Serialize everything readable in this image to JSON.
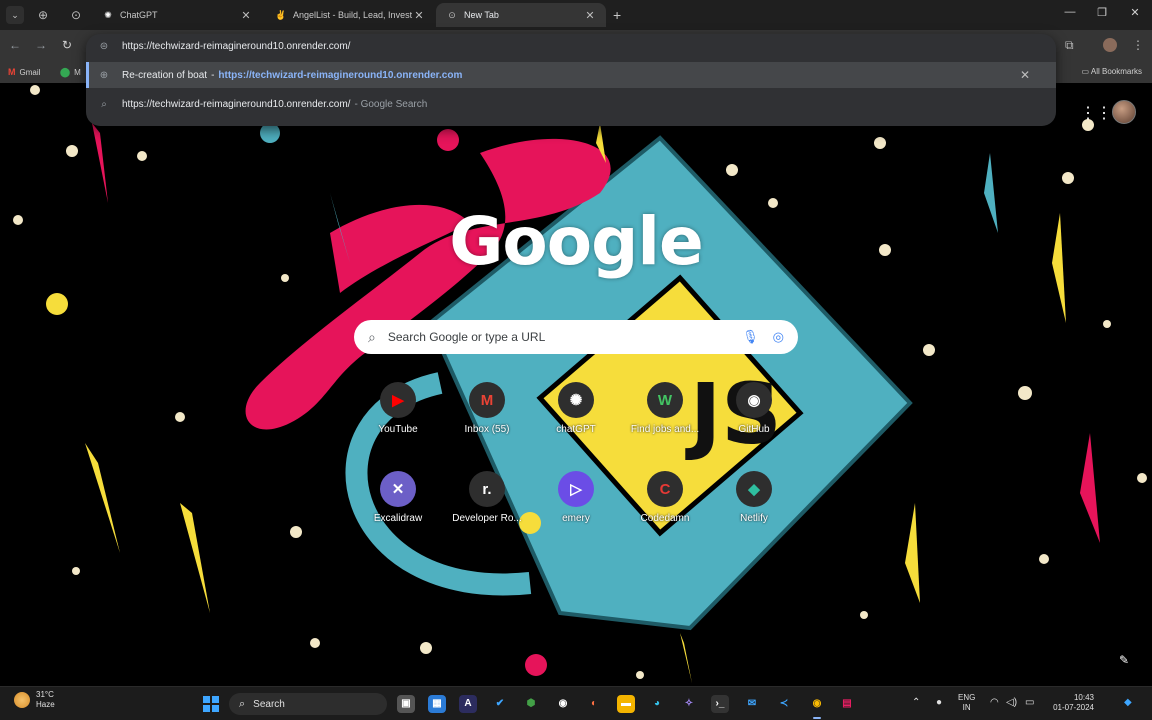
{
  "tabs": [
    {
      "title": "ChatGPT",
      "icon": "chatgpt-icon",
      "active": false
    },
    {
      "title": "AngelList - Build, Lead, Invest",
      "icon": "angellist-icon",
      "active": false
    },
    {
      "title": "New Tab",
      "icon": "chrome-icon",
      "active": true
    }
  ],
  "address_bar": {
    "value": "https://techwizard-reimagineround10.onrender.com/"
  },
  "suggestions": [
    {
      "title": "Re-creation of boat",
      "separator": "-",
      "url": "https://techwizard-reimagineround10.onrender.com",
      "icon": "globe-icon"
    },
    {
      "query": "https://techwizard-reimagineround10.onrender.com/",
      "sub": "- Google Search",
      "icon": "search-icon"
    }
  ],
  "bookmarks": {
    "items": [
      {
        "label": "Gmail"
      },
      {
        "label": "M"
      }
    ],
    "all_label": "All Bookmarks"
  },
  "ntp": {
    "logo_text": "Google",
    "search_placeholder": "Search Google or type a URL",
    "shortcuts": [
      {
        "label": "YouTube",
        "glyph": "▶",
        "color": "#ff0000"
      },
      {
        "label": "Inbox (55)",
        "glyph": "M",
        "color": "#ea4335"
      },
      {
        "label": "chatGPT",
        "glyph": "✺",
        "color": "#ffffff"
      },
      {
        "label": "Find jobs and...",
        "glyph": "W",
        "color": "#43c463"
      },
      {
        "label": "GitHub",
        "glyph": "◉",
        "color": "#ffffff"
      },
      {
        "label": "Excalidraw",
        "glyph": "✕",
        "color": "#ffffff"
      },
      {
        "label": "Developer Ro...",
        "glyph": "r.",
        "color": "#ffffff"
      },
      {
        "label": "emery",
        "glyph": "▷",
        "color": "#ffffff"
      },
      {
        "label": "Codedamn",
        "glyph": "C",
        "color": "#e53935"
      },
      {
        "label": "Netlify",
        "glyph": "◆",
        "color": "#2fbfa0"
      }
    ]
  },
  "taskbar": {
    "weather_temp": "31°C",
    "weather_desc": "Haze",
    "search_label": "Search",
    "lang_line1": "ENG",
    "lang_line2": "IN",
    "time": "10:43",
    "date": "01-07-2024"
  },
  "colors": {
    "accent": "#8ab4f8",
    "omnibox_bg": "#303134",
    "toolbar_bg": "#353535"
  }
}
